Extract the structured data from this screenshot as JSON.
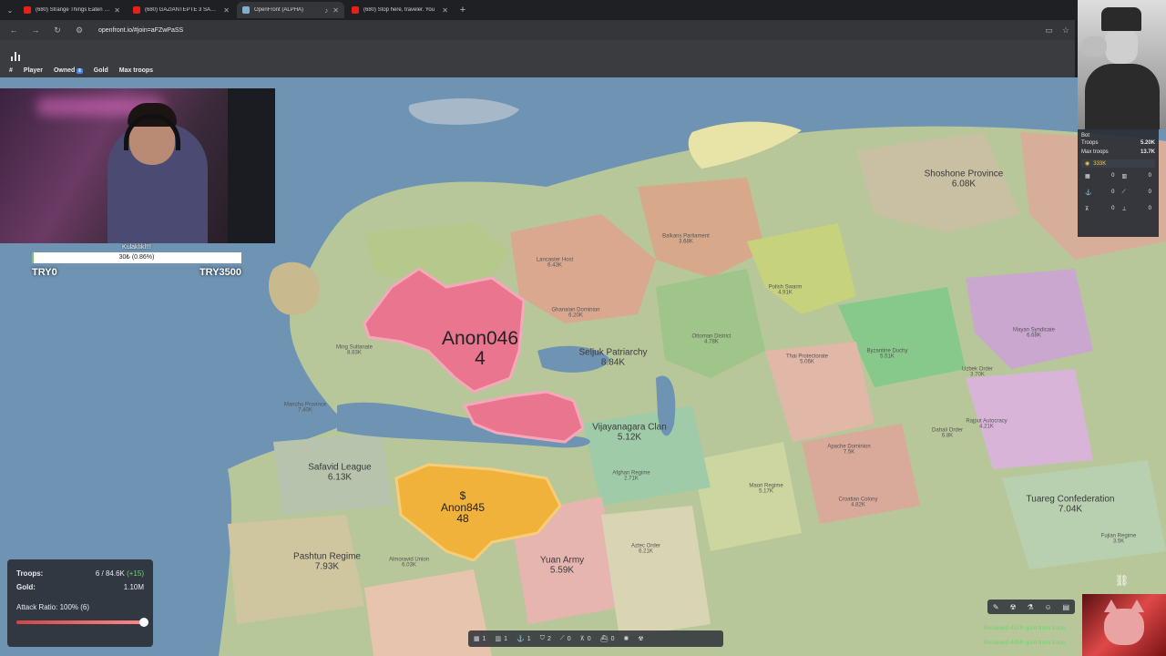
{
  "browser": {
    "tabs": [
      {
        "title": "(680) Strange Things Eaten in t",
        "fav": "#e62117",
        "active": false
      },
      {
        "title": "(680) GAZİANTEPTE 3 SAATTİ",
        "fav": "#e62117",
        "active": false
      },
      {
        "title": "OpenFront (ALPHA)",
        "fav": "#7fb0d0",
        "active": true
      },
      {
        "title": "(680) Stop here, traveler. You",
        "fav": "#e62117",
        "active": false
      }
    ],
    "new_tab": "+",
    "url": "openfront.io/#join=aFZwPaSS"
  },
  "leaderboard": {
    "icon": "bar-chart-icon",
    "columns": {
      "rank": "#",
      "player": "Player",
      "owned": "Owned",
      "owned_badge": "‖",
      "gold": "Gold",
      "max_troops": "Max troops"
    }
  },
  "donation": {
    "title": "Kulaklıkl!!!",
    "progress_text": "30₺ (0.86%)",
    "progress_fraction": 0.0086,
    "min_label": "TRY0",
    "max_label": "TRY3500"
  },
  "bot_panel": {
    "name": "Bot",
    "troops_label": "Troops",
    "troops_value": "5.20K",
    "max_troops_label": "Max troops",
    "max_troops_value": "13.7K",
    "gold_value": "333K",
    "buildings": [
      "0",
      "0",
      "0",
      "0",
      "0",
      "0"
    ]
  },
  "stats": {
    "troops_label": "Troops:",
    "troops_value": "6 / 84.6K",
    "troops_gain": "(+15)",
    "gold_label": "Gold:",
    "gold_value": "1.10M",
    "attack_label": "Attack Ratio: 100% (6)",
    "attack_fraction": 1.0
  },
  "build_bar": {
    "items": [
      {
        "icon": "city-icon",
        "count": "1"
      },
      {
        "icon": "factory-icon",
        "count": "1"
      },
      {
        "icon": "port-icon",
        "count": "1"
      },
      {
        "icon": "defense-post-icon",
        "count": "2"
      },
      {
        "icon": "missile-silo-icon",
        "count": "0"
      },
      {
        "icon": "sam-launcher-icon",
        "count": "0"
      },
      {
        "icon": "warship-icon",
        "count": "0"
      },
      {
        "icon": "nuke-icon",
        "count": ""
      },
      {
        "icon": "mirv-icon",
        "count": ""
      }
    ]
  },
  "messages": [
    "Received 437K gold from trade",
    "Received 445K gold from trade"
  ],
  "map": {
    "players": [
      {
        "name": "Anon046",
        "troops": "4",
        "color": "#e9758f"
      },
      {
        "name": "Anon845",
        "troops": "48",
        "color": "#f0b23a"
      }
    ],
    "regions_big": [
      {
        "name": "Shoshone Province",
        "value": "6.08K"
      },
      {
        "name": "Seljuk Patriarchy",
        "value": "8.84K"
      },
      {
        "name": "Vijayanagara Clan",
        "value": "5.12K"
      },
      {
        "name": "Safavid League",
        "value": "6.13K"
      },
      {
        "name": "Pashtun Regime",
        "value": "7.93K"
      },
      {
        "name": "Yuan Army",
        "value": "5.59K"
      },
      {
        "name": "Tuareg Confederation",
        "value": "7.04K"
      }
    ],
    "regions_small": [
      {
        "name": "Lancaster Host",
        "value": "6.43K"
      },
      {
        "name": "Ghanaian Dominion",
        "value": "6.20K"
      },
      {
        "name": "Ottoman District",
        "value": "4.78K"
      },
      {
        "name": "Thai Protectorate",
        "value": "5.06K"
      },
      {
        "name": "Mayan Syndicate",
        "value": "6.68K"
      },
      {
        "name": "Byzantine Duchy",
        "value": "5.51K"
      },
      {
        "name": "Uzbek Order",
        "value": "3.70K"
      },
      {
        "name": "Rajput Autocracy",
        "value": "4.21K"
      },
      {
        "name": "Apache Dominion",
        "value": "7.5K"
      },
      {
        "name": "Maori Regime",
        "value": "5.17K"
      },
      {
        "name": "Almoravid Union",
        "value": "6.03K"
      },
      {
        "name": "Polish Swarm",
        "value": "4.91K"
      },
      {
        "name": "Balkans Parliament",
        "value": "3.68K"
      },
      {
        "name": "Ming Sultanate",
        "value": "8.83K"
      },
      {
        "name": "Manchu Province",
        "value": "7.40K"
      },
      {
        "name": "Afghan Regime",
        "value": "2.71K"
      },
      {
        "name": "Aztec Order",
        "value": "6.21K"
      },
      {
        "name": "Croatian Colony",
        "value": "4.82K"
      },
      {
        "name": "Dahali Order",
        "value": "6.8K"
      },
      {
        "name": "Fujian Regime",
        "value": "3.5K"
      }
    ]
  },
  "colors": {
    "ocean": "#6e93b3",
    "accent_pink": "#e9758f",
    "accent_gold": "#f0b23a",
    "gain_green": "#6fd36f"
  }
}
